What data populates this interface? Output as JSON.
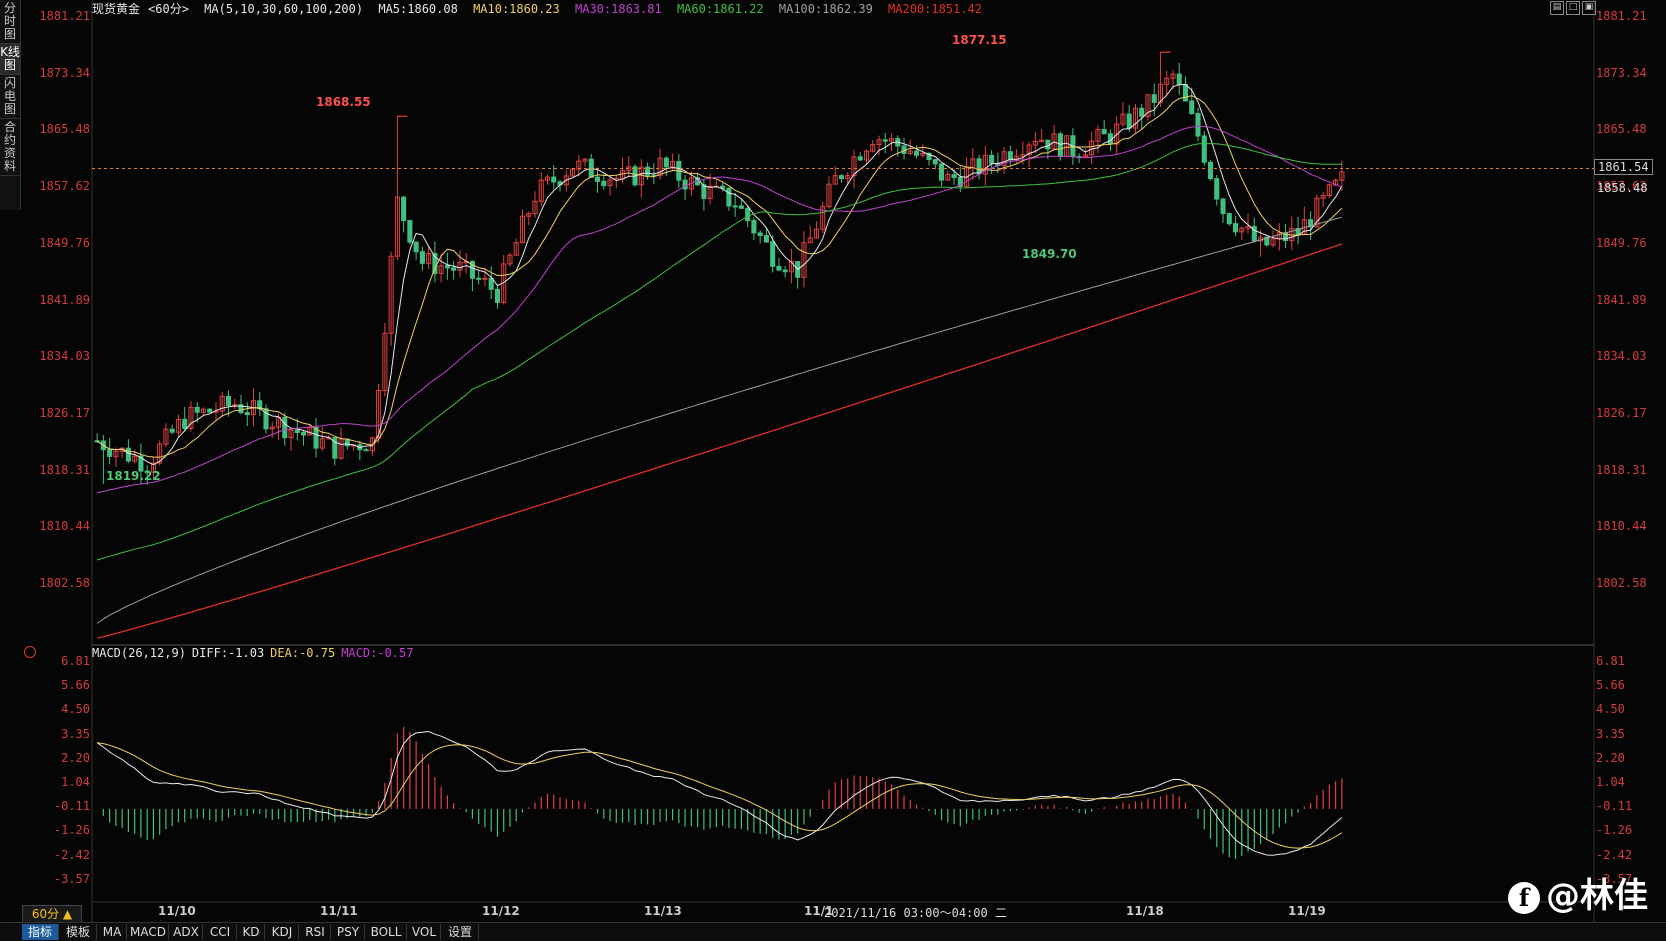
{
  "side_tabs": [
    "分时图",
    "K线图",
    "闪电图",
    "合约资料"
  ],
  "active_side_tab": 1,
  "header": {
    "symbol": "现货黄金",
    "period": "<60分>",
    "ma_params": "MA(5,10,30,60,100,200)",
    "ma5": "MA5:1860.08",
    "ma10": "MA10:1860.23",
    "ma30": "MA30:1863.81",
    "ma60": "MA60:1861.22",
    "ma100": "MA100:1862.39",
    "ma200": "MA200:1851.42"
  },
  "colors": {
    "ma5": "#e8e8e8",
    "ma10": "#f0d060",
    "ma30": "#c040d0",
    "ma60": "#40c040",
    "ma100": "#a0a0a0",
    "ma200": "#e03020",
    "up": "#e04040",
    "down": "#40c080",
    "axis": "#d23c3c"
  },
  "price_axis": [
    "1881.21",
    "1873.34",
    "1865.48",
    "1857.62",
    "1849.76",
    "1841.89",
    "1834.03",
    "1826.17",
    "1818.31",
    "1810.44",
    "1802.58"
  ],
  "current_price": "1861.54",
  "secondary_price": "1858.48",
  "annotations": {
    "high1": "1868.55",
    "high2": "1877.15",
    "low1": "1819.22",
    "low2": "1849.70"
  },
  "macd": {
    "params": "MACD(26,12,9)",
    "diff": "DIFF:-1.03",
    "dea": "DEA:-0.75",
    "macd": "MACD:-0.57",
    "axis": [
      "6.81",
      "5.66",
      "4.50",
      "3.35",
      "2.20",
      "1.04",
      "-0.11",
      "-1.26",
      "-2.42",
      "-3.57"
    ]
  },
  "dates": [
    "11/10",
    "11/11",
    "11/12",
    "11/13",
    "11/1",
    "2021/11/16 03:00～04:00 二",
    "11/18",
    "11/19"
  ],
  "period_button": "60分 ▲",
  "bottom_tabs": [
    "指标",
    "模板",
    "MA",
    "MACD",
    "ADX",
    "CCI",
    "KD",
    "KDJ",
    "RSI",
    "PSY",
    "BOLL",
    "VOL",
    "设置"
  ],
  "active_bottom_tab": 0,
  "watermark": "@林佳",
  "watermark_logo": "f",
  "chart_data": {
    "type": "candlestick",
    "title": "现货黄金 <60分>",
    "ylim": [
      1798,
      1882
    ],
    "markers": [
      {
        "label": "1868.55",
        "value": 1868.55
      },
      {
        "label": "1877.15",
        "value": 1877.15
      },
      {
        "label": "1819.22",
        "value": 1819.22
      },
      {
        "label": "1849.70",
        "value": 1849.7
      }
    ],
    "ma200_end": 1851.42,
    "macd_ylim": [
      -4.5,
      7.2
    ],
    "macd_last": {
      "diff": -1.03,
      "dea": -0.75,
      "macd": -0.57
    }
  }
}
